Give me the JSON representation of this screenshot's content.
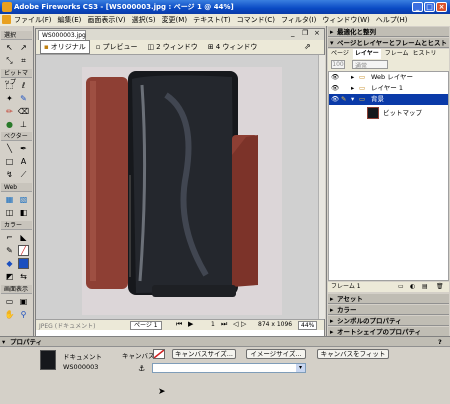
{
  "window": {
    "title": "Adobe Fireworks CS3 - [WS000003.jpg : ページ 1 @ 44%]"
  },
  "menu": [
    "ファイル(F)",
    "編集(E)",
    "画面表示(V)",
    "選択(S)",
    "変更(M)",
    "テキスト(T)",
    "コマンド(C)",
    "フィルタ(I)",
    "ウィンドウ(W)",
    "ヘルプ(H)"
  ],
  "tools": {
    "select": "選択",
    "bitmap": "ビットマップ",
    "vector": "ベクター",
    "web": "Web",
    "color": "カラー",
    "view": "画面表示"
  },
  "document": {
    "tab": "WS000003.jpg",
    "views": [
      "オリジナル",
      "プレビュー",
      "2 ウィンドウ",
      "4 ウィンドウ"
    ],
    "status_left": "JPEG (ドキュメント)",
    "page": "ページ 1",
    "frame": "1",
    "size": "874 x 1096",
    "zoom": "44%"
  },
  "panels": {
    "optimize": "最適化と整列",
    "pages_layers": "ページとレイヤーとフレームとヒストリ",
    "tabs": [
      "ページ",
      "レイヤー",
      "フレーム",
      "ヒストリ"
    ],
    "opacity": "100",
    "blend": "通常",
    "layers": [
      {
        "name": "Web レイヤー"
      },
      {
        "name": "レイヤー 1"
      },
      {
        "name": "背景"
      },
      {
        "name": "ビットマップ"
      }
    ],
    "frame_label": "フレーム 1",
    "assets": "アセット",
    "colors": "カラー",
    "symbol": "シンボルのプロパティ",
    "autoshape": "オートシェイプのプロパティ"
  },
  "properties": {
    "title": "プロパティ",
    "doc_label": "ドキュメント",
    "doc_name": "WS000003",
    "canvas_label": "キャンバス:",
    "btn_canvas_size": "キャンバスサイズ...",
    "btn_image_size": "イメージサイズ...",
    "btn_fit": "キャンバスをフィット"
  },
  "colors": {
    "titlebar": "#0a4ac4",
    "selected_layer": "#0a3aa8",
    "wallet_leather": "#8e3f34",
    "wallet_black": "#16181c"
  }
}
